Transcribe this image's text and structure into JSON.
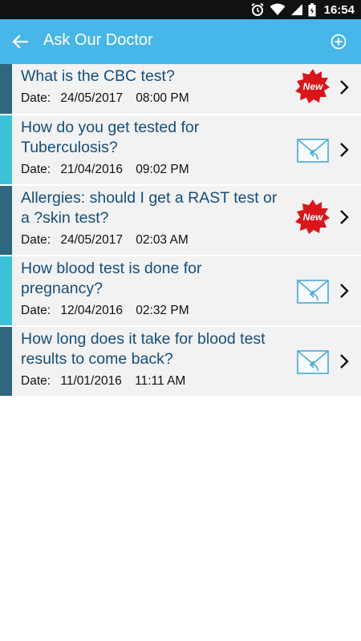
{
  "status": {
    "time": "16:54"
  },
  "appbar": {
    "title": "Ask Our Doctor"
  },
  "questions": [
    {
      "title": "What is the CBC test?",
      "date_label": "Date:",
      "date": "24/05/2017",
      "time": "08:00 PM",
      "badge": "new",
      "badge_text": "New",
      "accent": "#2f6680"
    },
    {
      "title": "How do you get tested for Tuberculosis?",
      "date_label": "Date:",
      "date": "21/04/2016",
      "time": "09:02 PM",
      "badge": "envelope",
      "accent": "#3dc1d9"
    },
    {
      "title": "Allergies: should I get a RAST test or a ?skin test?",
      "date_label": "Date:",
      "date": "24/05/2017",
      "time": "02:03 AM",
      "badge": "new",
      "badge_text": "New",
      "accent": "#2f6680"
    },
    {
      "title": "How blood test is done for pregnancy?",
      "date_label": "Date:",
      "date": "12/04/2016",
      "time": "02:32 PM",
      "badge": "envelope",
      "accent": "#3dc1d9"
    },
    {
      "title": "How long does it take for blood test results to come back?",
      "date_label": "Date:",
      "date": "11/01/2016",
      "time": "11:11 AM",
      "badge": "envelope",
      "accent": "#2f6680"
    }
  ]
}
